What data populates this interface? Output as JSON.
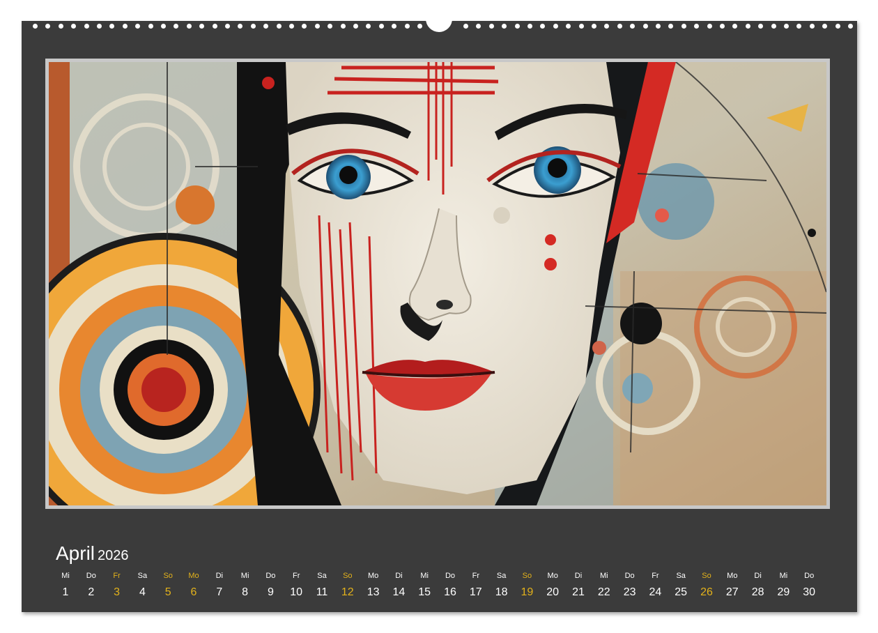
{
  "calendar": {
    "month": "April",
    "year": "2026",
    "highlight_color": "#e3b21b",
    "days": [
      {
        "dow": "Mi",
        "num": "1",
        "hl": false
      },
      {
        "dow": "Do",
        "num": "2",
        "hl": false
      },
      {
        "dow": "Fr",
        "num": "3",
        "hl": true
      },
      {
        "dow": "Sa",
        "num": "4",
        "hl": false
      },
      {
        "dow": "So",
        "num": "5",
        "hl": true
      },
      {
        "dow": "Mo",
        "num": "6",
        "hl": true
      },
      {
        "dow": "Di",
        "num": "7",
        "hl": false
      },
      {
        "dow": "Mi",
        "num": "8",
        "hl": false
      },
      {
        "dow": "Do",
        "num": "9",
        "hl": false
      },
      {
        "dow": "Fr",
        "num": "10",
        "hl": false
      },
      {
        "dow": "Sa",
        "num": "11",
        "hl": false
      },
      {
        "dow": "So",
        "num": "12",
        "hl": true
      },
      {
        "dow": "Mo",
        "num": "13",
        "hl": false
      },
      {
        "dow": "Di",
        "num": "14",
        "hl": false
      },
      {
        "dow": "Mi",
        "num": "15",
        "hl": false
      },
      {
        "dow": "Do",
        "num": "16",
        "hl": false
      },
      {
        "dow": "Fr",
        "num": "17",
        "hl": false
      },
      {
        "dow": "Sa",
        "num": "18",
        "hl": false
      },
      {
        "dow": "So",
        "num": "19",
        "hl": true
      },
      {
        "dow": "Mo",
        "num": "20",
        "hl": false
      },
      {
        "dow": "Di",
        "num": "21",
        "hl": false
      },
      {
        "dow": "Mi",
        "num": "22",
        "hl": false
      },
      {
        "dow": "Do",
        "num": "23",
        "hl": false
      },
      {
        "dow": "Fr",
        "num": "24",
        "hl": false
      },
      {
        "dow": "Sa",
        "num": "25",
        "hl": false
      },
      {
        "dow": "So",
        "num": "26",
        "hl": true
      },
      {
        "dow": "Mo",
        "num": "27",
        "hl": false
      },
      {
        "dow": "Di",
        "num": "28",
        "hl": false
      },
      {
        "dow": "Mi",
        "num": "29",
        "hl": false
      },
      {
        "dow": "Do",
        "num": "30",
        "hl": false
      }
    ]
  }
}
